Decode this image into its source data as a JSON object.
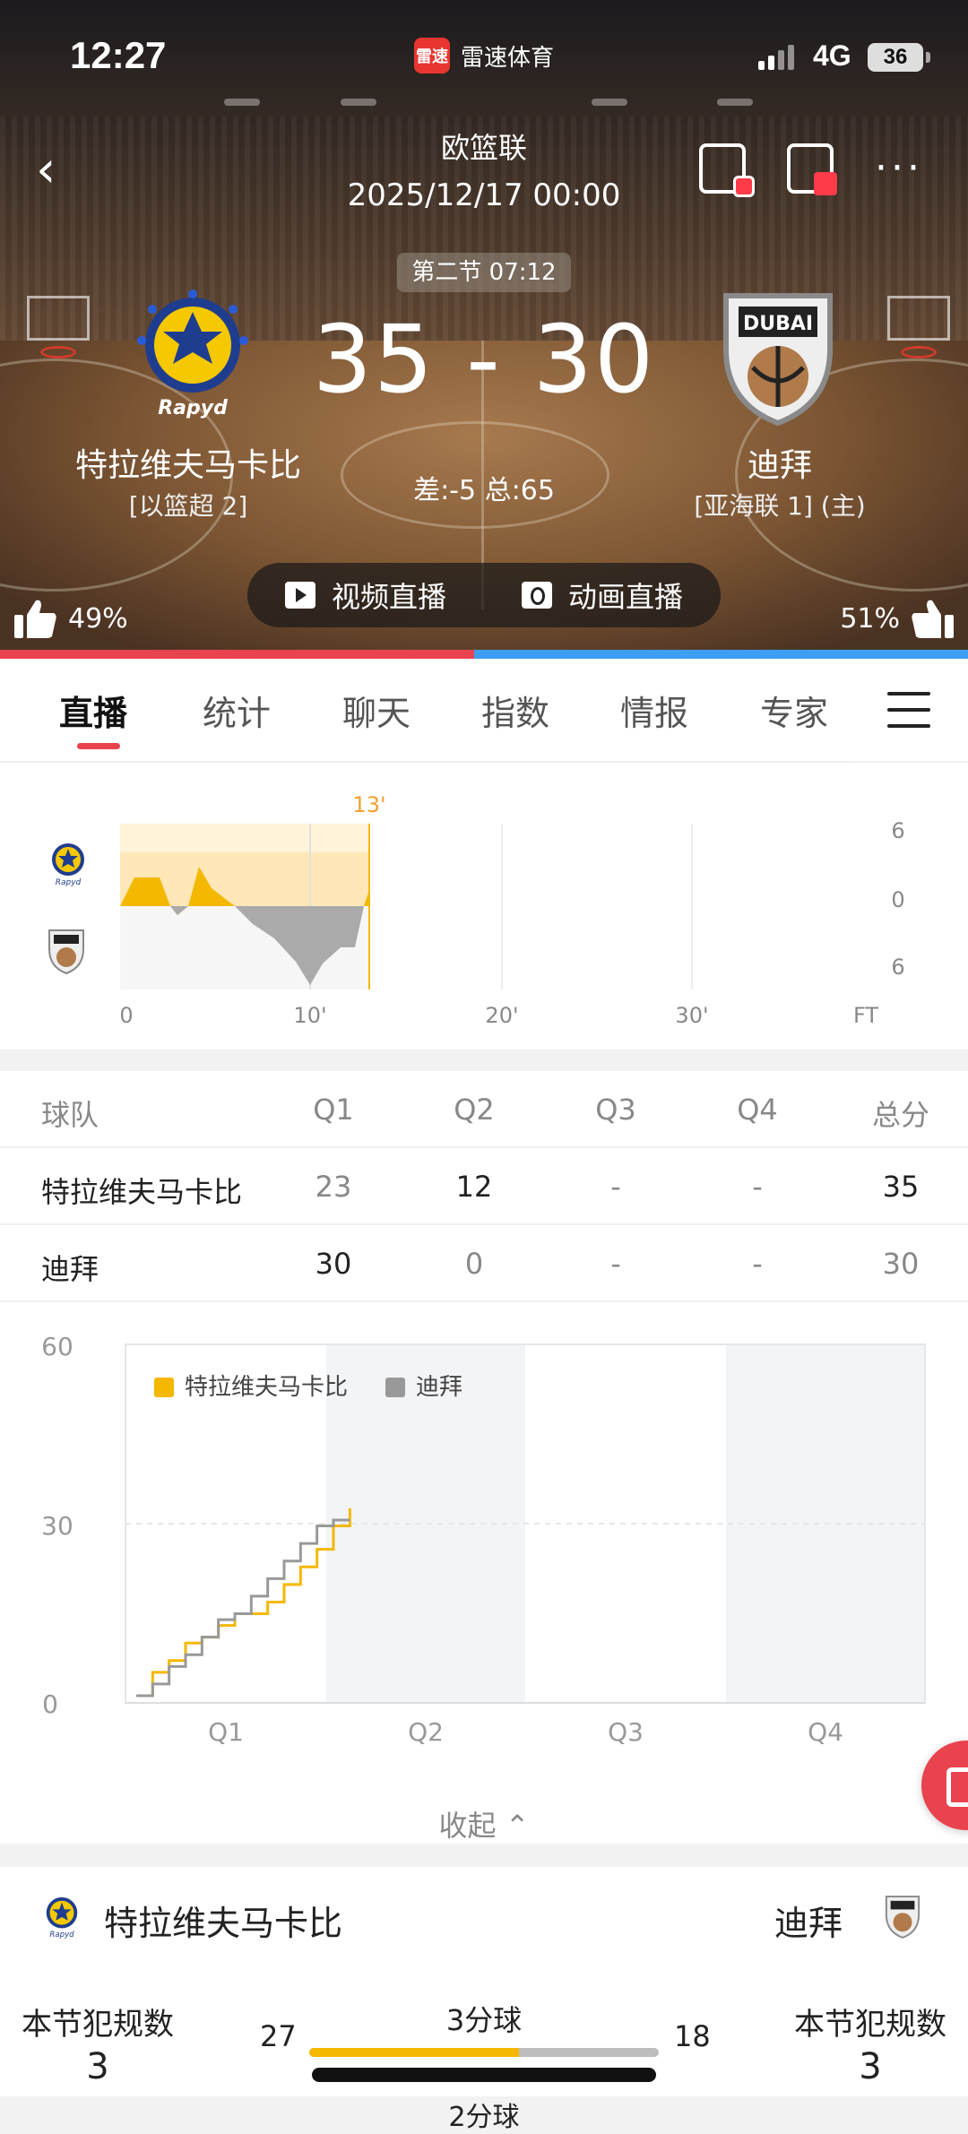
{
  "status_bar": {
    "time": "12:27",
    "app_name": "雷速体育",
    "app_logo_text": "雷速",
    "network": "4G",
    "battery": "36"
  },
  "match": {
    "league": "欧篮联",
    "datetime": "2025/12/17 00:00",
    "period": "第二节 07:12",
    "score": "35 - 30",
    "diff_total": "差:-5 总:65"
  },
  "home": {
    "name": "特拉维夫马卡比",
    "league": "[以篮超 2]",
    "logo_text": "Rapyd",
    "like_pct": "49%"
  },
  "away": {
    "name": "迪拜",
    "league": "[亚海联 1] (主)",
    "logo_text": "DUBAI",
    "like_pct": "51%"
  },
  "live": {
    "video": "视频直播",
    "animation": "动画直播"
  },
  "vote": {
    "home_fraction": 0.49,
    "home_color": "#e9434f",
    "away_color": "#3d9ef4"
  },
  "tabs": [
    "直播",
    "统计",
    "聊天",
    "指数",
    "情报",
    "专家"
  ],
  "active_tab": 0,
  "momentum": {
    "marker": "13'",
    "x_labels": [
      "0",
      "10'",
      "20'",
      "30'",
      "FT"
    ],
    "y_labels": [
      "6",
      "0",
      "6"
    ],
    "home_color": "#f5b800",
    "away_color": "#aaaaaa"
  },
  "score_table": {
    "headers": [
      "球队",
      "Q1",
      "Q2",
      "Q3",
      "Q4",
      "总分"
    ],
    "rows": [
      {
        "team": "特拉维夫马卡比",
        "q": [
          "23",
          "12",
          "-",
          "-"
        ],
        "total": "35"
      },
      {
        "team": "迪拜",
        "q": [
          "30",
          "0",
          "-",
          "-"
        ],
        "total": "30"
      }
    ]
  },
  "chart_data": {
    "type": "line",
    "x": [
      0,
      1,
      2,
      3,
      4,
      5,
      6,
      7,
      8,
      9,
      10,
      11,
      12,
      13
    ],
    "series": [
      {
        "name": "特拉维夫马卡比",
        "color": "#f5b800",
        "values": [
          0,
          4,
          6,
          9,
          10,
          12,
          14,
          14,
          16,
          19,
          22,
          25,
          29,
          32
        ]
      },
      {
        "name": "迪拜",
        "color": "#999999",
        "values": [
          0,
          2,
          5,
          7,
          10,
          13,
          14,
          17,
          20,
          23,
          26,
          29,
          30,
          30
        ]
      }
    ],
    "categories": [
      "Q1",
      "Q2",
      "Q3",
      "Q4"
    ],
    "y_ticks": [
      "60",
      "30",
      "0"
    ],
    "ylim": [
      0,
      60
    ],
    "legend_position": "top-left",
    "grid": true
  },
  "collapse_label": "收起",
  "compare": {
    "home_name": "特拉维夫马卡比",
    "away_name": "迪拜",
    "foul_label": "本节犯规数",
    "home_fouls": "3",
    "away_fouls": "3",
    "stat_label": "3分球",
    "home_stat": "27",
    "away_stat": "18",
    "home_fraction": 0.6,
    "next_label": "2分球"
  }
}
